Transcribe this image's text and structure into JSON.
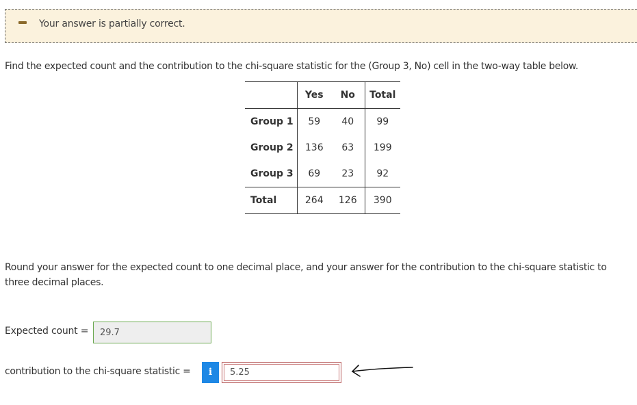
{
  "feedback": {
    "icon": "minus-icon",
    "message": "Your answer is partially correct."
  },
  "question": "Find the expected count and the contribution to the chi-square statistic for the (Group 3, No) cell in the two-way table below.",
  "table": {
    "columns": [
      "Yes",
      "No",
      "Total"
    ],
    "rows": [
      {
        "label": "Group 1",
        "values": [
          "59",
          "40",
          "99"
        ]
      },
      {
        "label": "Group 2",
        "values": [
          "136",
          "63",
          "199"
        ]
      },
      {
        "label": "Group 3",
        "values": [
          "69",
          "23",
          "92"
        ]
      },
      {
        "label": "Total",
        "values": [
          "264",
          "126",
          "390"
        ]
      }
    ]
  },
  "instructions": "Round your answer for the expected count to one decimal place, and your answer for the contribution to the chi-square statistic to three decimal places.",
  "expected": {
    "label": "Expected count =",
    "value": "29.7"
  },
  "contribution": {
    "label": "contribution to the chi-square statistic =",
    "info_icon": "info-icon",
    "info_glyph": "i",
    "value": "5.25"
  },
  "annotation": {
    "icon": "hand-drawn-arrow-icon"
  }
}
